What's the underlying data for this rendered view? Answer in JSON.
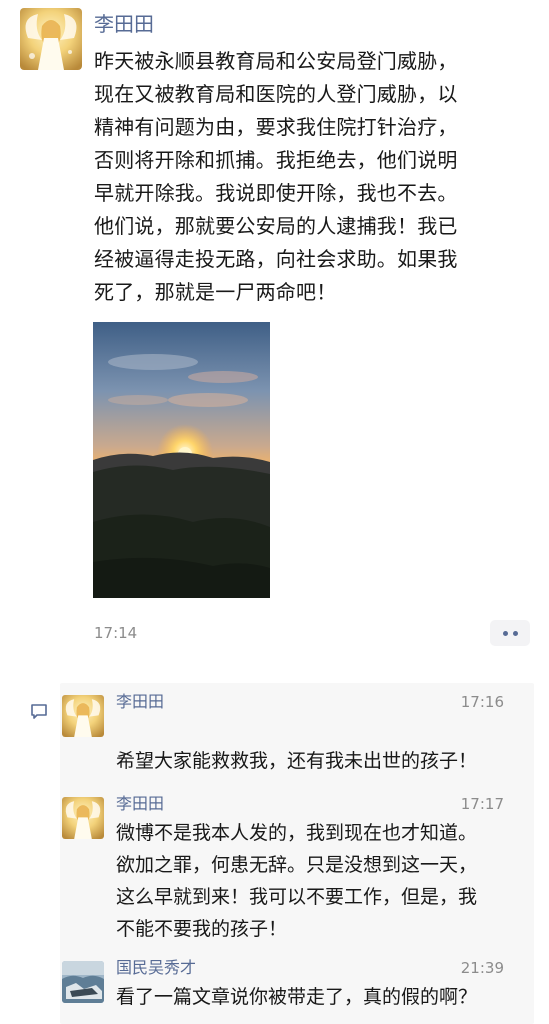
{
  "post": {
    "author": "李田田",
    "body_lines": [
      "昨天被永顺县教育局和公安局登门威胁，",
      "现在又被教育局和医院的人登门威胁，以",
      "精神有问题为由，要求我住院打针治疗，",
      "否则将开除和抓捕。我拒绝去，他们说明",
      "早就开除我。我说即使开除，我也不去。",
      "他们说，那就要公安局的人逮捕我！我已",
      "经被逼得走投无路，向社会求助。如果我",
      "死了，那就是一尸两命吧！"
    ],
    "time": "17:14"
  },
  "comments": [
    {
      "name": "李田田",
      "time": "17:16",
      "text_lines": [
        "希望大家能救救我，还有我未出世的孩子！"
      ]
    },
    {
      "name": "李田田",
      "time": "17:17",
      "text_lines": [
        "微博不是我本人发的，我到现在也才知道。",
        "欲加之罪，何患无辞。只是没想到这一天，",
        "这么早就到来！我可以不要工作，但是，我",
        "不能不要我的孩子！"
      ]
    },
    {
      "name": "国民吴秀才",
      "time": "21:39",
      "text_lines": [
        "看了一篇文章说你被带走了，真的假的啊？"
      ]
    }
  ],
  "icons": {
    "comment": "comment-bubble-icon",
    "more": "more-dots-icon"
  },
  "colors": {
    "name": "#576b95",
    "text": "#191919",
    "time": "#8c8c8c",
    "comment_bg": "#f7f7f7"
  }
}
